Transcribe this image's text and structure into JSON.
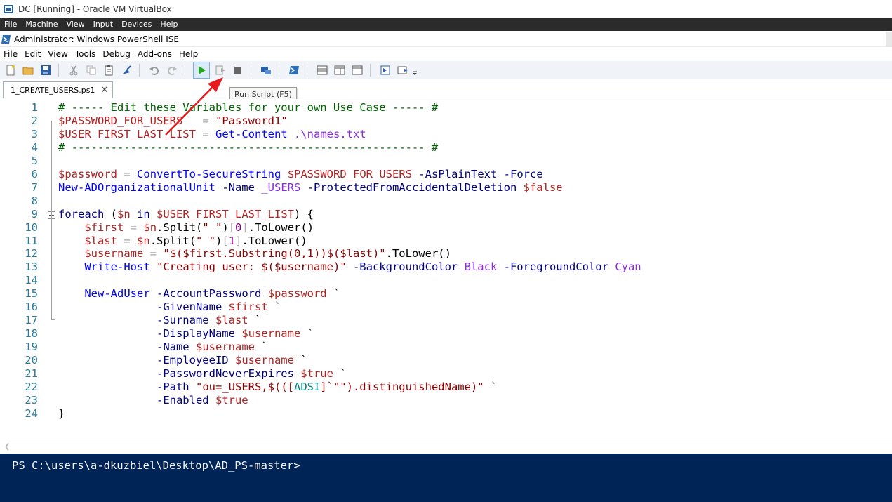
{
  "vbox": {
    "title": "DC [Running] - Oracle VM VirtualBox",
    "menu": [
      "File",
      "Machine",
      "View",
      "Input",
      "Devices",
      "Help"
    ]
  },
  "ise": {
    "title": "Administrator: Windows PowerShell ISE",
    "menu": [
      "File",
      "Edit",
      "View",
      "Tools",
      "Debug",
      "Add-ons",
      "Help"
    ],
    "tooltip": "Run Script (F5)",
    "tab": "1_CREATE_USERS.ps1",
    "tab_close": "✕",
    "colors": {
      "console_bg": "#012456",
      "run_green": "#22a81e",
      "annotation_red": "#e8191c"
    }
  },
  "editor": {
    "lines": [
      [
        [
          "c-comment",
          "# ----- Edit these Variables for your own Use Case ----- #"
        ]
      ],
      [
        [
          "c-var",
          "$PASSWORD_FOR_USERS"
        ],
        [
          "c-plain",
          "   "
        ],
        [
          "c-op",
          "="
        ],
        [
          "c-plain",
          " "
        ],
        [
          "c-str",
          "\"Password1\""
        ]
      ],
      [
        [
          "c-var",
          "$USER_FIRST_LAST_LIST"
        ],
        [
          "c-plain",
          " "
        ],
        [
          "c-op",
          "="
        ],
        [
          "c-plain",
          " "
        ],
        [
          "c-cmd",
          "Get-Content"
        ],
        [
          "c-plain",
          " "
        ],
        [
          "c-purple",
          ".\\names.txt"
        ]
      ],
      [
        [
          "c-comment",
          "# ------------------------------------------------------ #"
        ]
      ],
      [],
      [
        [
          "c-var",
          "$password"
        ],
        [
          "c-plain",
          " "
        ],
        [
          "c-op",
          "="
        ],
        [
          "c-plain",
          " "
        ],
        [
          "c-cmd",
          "ConvertTo-SecureString"
        ],
        [
          "c-plain",
          " "
        ],
        [
          "c-var",
          "$PASSWORD_FOR_USERS"
        ],
        [
          "c-plain",
          " "
        ],
        [
          "c-param",
          "-AsPlainText"
        ],
        [
          "c-plain",
          " "
        ],
        [
          "c-param",
          "-Force"
        ]
      ],
      [
        [
          "c-cmd",
          "New-ADOrganizationalUnit"
        ],
        [
          "c-plain",
          " "
        ],
        [
          "c-param",
          "-Name"
        ],
        [
          "c-plain",
          " "
        ],
        [
          "c-purple",
          "_USERS"
        ],
        [
          "c-plain",
          " "
        ],
        [
          "c-param",
          "-ProtectedFromAccidentalDeletion"
        ],
        [
          "c-plain",
          " "
        ],
        [
          "c-var",
          "$false"
        ]
      ],
      [],
      [
        [
          "c-kw",
          "foreach"
        ],
        [
          "c-plain",
          " ("
        ],
        [
          "c-var",
          "$n"
        ],
        [
          "c-plain",
          " "
        ],
        [
          "c-kw",
          "in"
        ],
        [
          "c-plain",
          " "
        ],
        [
          "c-var",
          "$USER_FIRST_LAST_LIST"
        ],
        [
          "c-plain",
          ") {"
        ]
      ],
      [
        [
          "c-plain",
          "    "
        ],
        [
          "c-var",
          "$first"
        ],
        [
          "c-plain",
          " "
        ],
        [
          "c-op",
          "="
        ],
        [
          "c-plain",
          " "
        ],
        [
          "c-var",
          "$n"
        ],
        [
          "c-plain",
          ".Split("
        ],
        [
          "c-str",
          "\" \""
        ],
        [
          "c-plain",
          ")"
        ],
        [
          "c-op",
          "["
        ],
        [
          "c-num",
          "0"
        ],
        [
          "c-op",
          "]"
        ],
        [
          "c-plain",
          ".ToLower()"
        ]
      ],
      [
        [
          "c-plain",
          "    "
        ],
        [
          "c-var",
          "$last"
        ],
        [
          "c-plain",
          " "
        ],
        [
          "c-op",
          "="
        ],
        [
          "c-plain",
          " "
        ],
        [
          "c-var",
          "$n"
        ],
        [
          "c-plain",
          ".Split("
        ],
        [
          "c-str",
          "\" \""
        ],
        [
          "c-plain",
          ")"
        ],
        [
          "c-op",
          "["
        ],
        [
          "c-num",
          "1"
        ],
        [
          "c-op",
          "]"
        ],
        [
          "c-plain",
          ".ToLower()"
        ]
      ],
      [
        [
          "c-plain",
          "    "
        ],
        [
          "c-var",
          "$username"
        ],
        [
          "c-plain",
          " "
        ],
        [
          "c-op",
          "="
        ],
        [
          "c-plain",
          " "
        ],
        [
          "c-str",
          "\"$($first.Substring(0,1))$($last)\""
        ],
        [
          "c-plain",
          ".ToLower()"
        ]
      ],
      [
        [
          "c-plain",
          "    "
        ],
        [
          "c-cmd",
          "Write-Host"
        ],
        [
          "c-plain",
          " "
        ],
        [
          "c-str",
          "\"Creating user: $($username)\""
        ],
        [
          "c-plain",
          " "
        ],
        [
          "c-param",
          "-BackgroundColor"
        ],
        [
          "c-plain",
          " "
        ],
        [
          "c-purple",
          "Black"
        ],
        [
          "c-plain",
          " "
        ],
        [
          "c-param",
          "-ForegroundColor"
        ],
        [
          "c-plain",
          " "
        ],
        [
          "c-purple",
          "Cyan"
        ]
      ],
      [],
      [
        [
          "c-plain",
          "    "
        ],
        [
          "c-cmd",
          "New-AdUser"
        ],
        [
          "c-plain",
          " "
        ],
        [
          "c-param",
          "-AccountPassword"
        ],
        [
          "c-plain",
          " "
        ],
        [
          "c-var",
          "$password"
        ],
        [
          "c-plain",
          " `"
        ]
      ],
      [
        [
          "c-plain",
          "               "
        ],
        [
          "c-param",
          "-GivenName"
        ],
        [
          "c-plain",
          " "
        ],
        [
          "c-var",
          "$first"
        ],
        [
          "c-plain",
          " `"
        ]
      ],
      [
        [
          "c-plain",
          "               "
        ],
        [
          "c-param",
          "-Surname"
        ],
        [
          "c-plain",
          " "
        ],
        [
          "c-var",
          "$last"
        ],
        [
          "c-plain",
          " `"
        ]
      ],
      [
        [
          "c-plain",
          "               "
        ],
        [
          "c-param",
          "-DisplayName"
        ],
        [
          "c-plain",
          " "
        ],
        [
          "c-var",
          "$username"
        ],
        [
          "c-plain",
          " `"
        ]
      ],
      [
        [
          "c-plain",
          "               "
        ],
        [
          "c-param",
          "-Name"
        ],
        [
          "c-plain",
          " "
        ],
        [
          "c-var",
          "$username"
        ],
        [
          "c-plain",
          " `"
        ]
      ],
      [
        [
          "c-plain",
          "               "
        ],
        [
          "c-param",
          "-EmployeeID"
        ],
        [
          "c-plain",
          " "
        ],
        [
          "c-var",
          "$username"
        ],
        [
          "c-plain",
          " `"
        ]
      ],
      [
        [
          "c-plain",
          "               "
        ],
        [
          "c-param",
          "-PasswordNeverExpires"
        ],
        [
          "c-plain",
          " "
        ],
        [
          "c-var",
          "$true"
        ],
        [
          "c-plain",
          " `"
        ]
      ],
      [
        [
          "c-plain",
          "               "
        ],
        [
          "c-param",
          "-Path"
        ],
        [
          "c-plain",
          " "
        ],
        [
          "c-str",
          "\"ou=_USERS,$((["
        ],
        [
          "c-type",
          "ADSI"
        ],
        [
          "c-str",
          "]`\"\").distinguishedName)\""
        ],
        [
          "c-plain",
          " `"
        ]
      ],
      [
        [
          "c-plain",
          "               "
        ],
        [
          "c-param",
          "-Enabled"
        ],
        [
          "c-plain",
          " "
        ],
        [
          "c-var",
          "$true"
        ]
      ],
      [
        [
          "c-plain",
          "}"
        ]
      ]
    ]
  },
  "console": {
    "prompt": "PS C:\\users\\a-dkuzbiel\\Desktop\\AD_PS-master>"
  }
}
